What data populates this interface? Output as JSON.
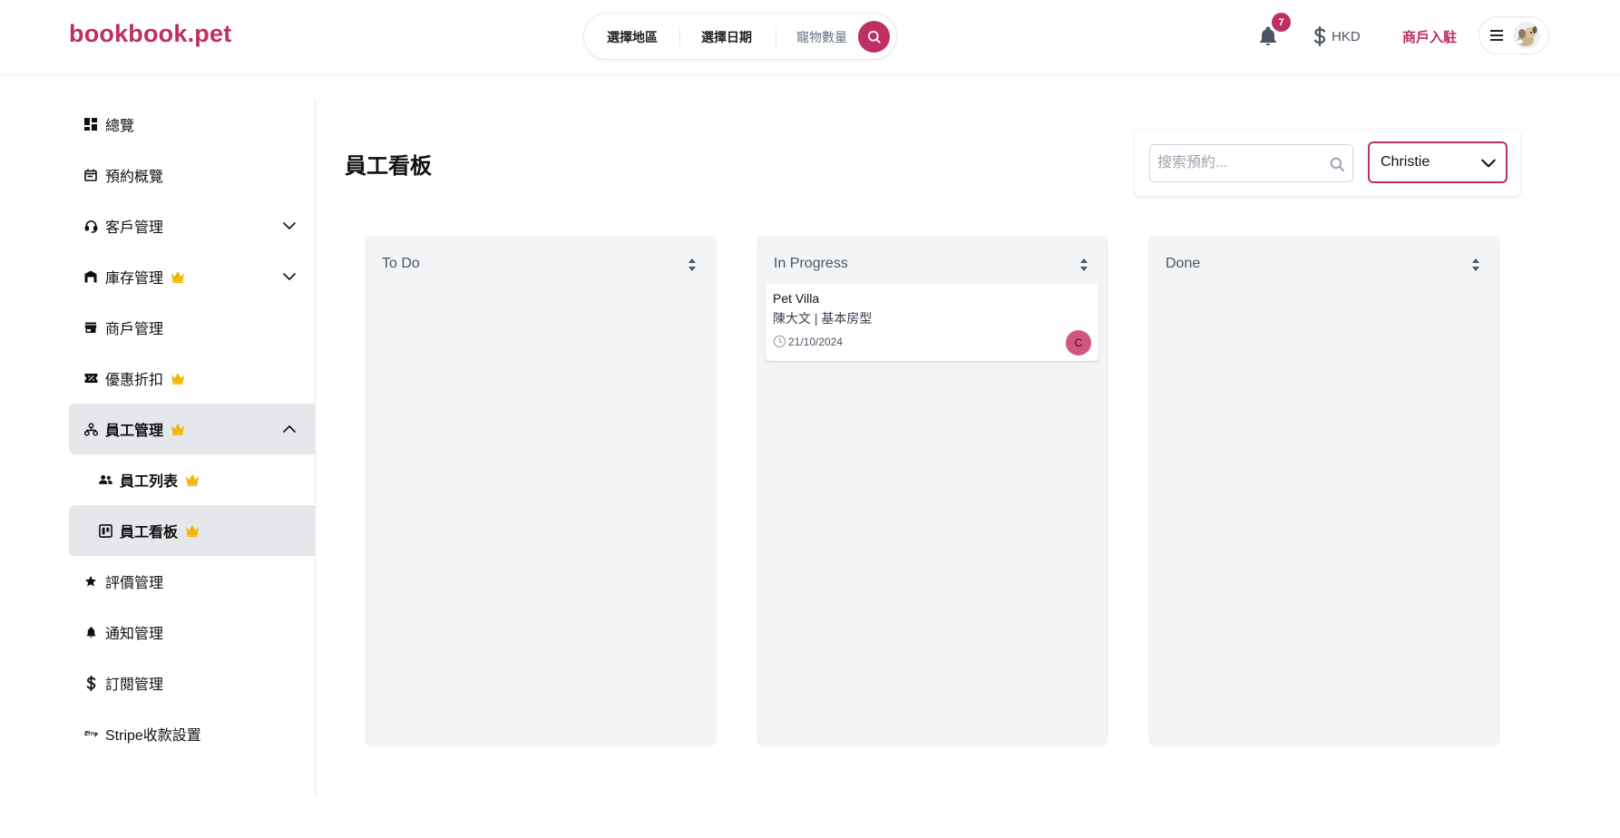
{
  "header": {
    "logo": "bookbook.pet",
    "search": {
      "region": "選擇地區",
      "date": "選擇日期",
      "pets": "寵物數量"
    },
    "notification_count": "7",
    "currency": "HKD",
    "merchant_link": "商戶入駐"
  },
  "sidebar": {
    "items": [
      {
        "label": "總覽",
        "icon": "dashboard-icon"
      },
      {
        "label": "預約概覽",
        "icon": "calendar-icon"
      },
      {
        "label": "客戶管理",
        "icon": "headset-icon",
        "expandable": true
      },
      {
        "label": "庫存管理",
        "icon": "warehouse-icon",
        "premium": true,
        "expandable": true
      },
      {
        "label": "商戶管理",
        "icon": "store-icon"
      },
      {
        "label": "優惠折扣",
        "icon": "ticket-icon",
        "premium": true
      },
      {
        "label": "員工管理",
        "icon": "org-chart-icon",
        "premium": true,
        "expanded": true,
        "active": true
      },
      {
        "label": "員工列表",
        "icon": "people-icon",
        "premium": true,
        "sub": true
      },
      {
        "label": "員工看板",
        "icon": "kanban-icon",
        "premium": true,
        "sub": true,
        "active": true
      },
      {
        "label": "評價管理",
        "icon": "star-icon"
      },
      {
        "label": "通知管理",
        "icon": "bell-icon"
      },
      {
        "label": "訂閱管理",
        "icon": "dollar-icon"
      },
      {
        "label": "Stripe收款設置",
        "icon": "stripe-icon"
      }
    ]
  },
  "main": {
    "title": "員工看板",
    "search_placeholder": "搜索預約...",
    "staff_selected": "Christie",
    "columns": [
      {
        "title": "To Do",
        "cards": []
      },
      {
        "title": "In Progress",
        "cards": [
          {
            "merchant": "Pet Villa",
            "detail": "陳大文 | 基本房型",
            "date": "21/10/2024",
            "assignee_initial": "C"
          }
        ]
      },
      {
        "title": "Done",
        "cards": []
      }
    ]
  },
  "colors": {
    "brand": "#be2f63",
    "crown": "#f2b705",
    "column_bg": "#f3f4f6",
    "active_nav_bg": "#e5e7eb"
  }
}
